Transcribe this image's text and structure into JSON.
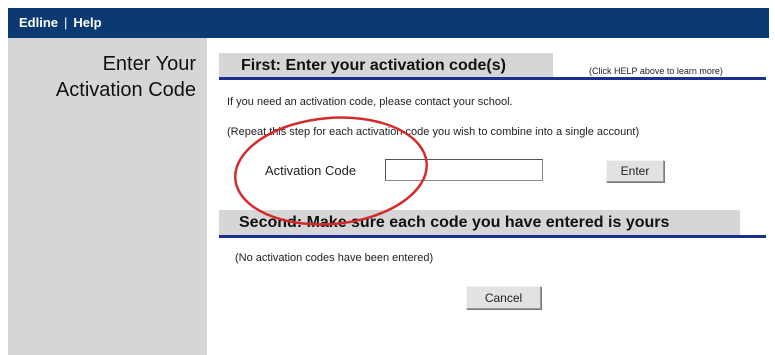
{
  "topbar": {
    "brand": "Edline",
    "separator": "|",
    "help": "Help"
  },
  "left": {
    "title_line1": "Enter Your",
    "title_line2": "Activation Code"
  },
  "first": {
    "heading": "First: Enter your activation code(s)",
    "help_note": "(Click HELP above to learn more)",
    "contact_text": "If you need an activation code, please contact your school.",
    "repeat_text": "(Repeat this step for each activation code you wish to combine into a single account)",
    "field_label": "Activation Code",
    "field_value": "",
    "enter_label": "Enter"
  },
  "second": {
    "heading": "Second: Make sure each code you have entered is yours",
    "empty_text": "(No activation codes have been entered)",
    "cancel_label": "Cancel"
  },
  "colors": {
    "topbar": "#0b3a73",
    "panel": "#d6d6d6",
    "rule": "#1a2f8e",
    "annotation": "#d42a2a"
  }
}
